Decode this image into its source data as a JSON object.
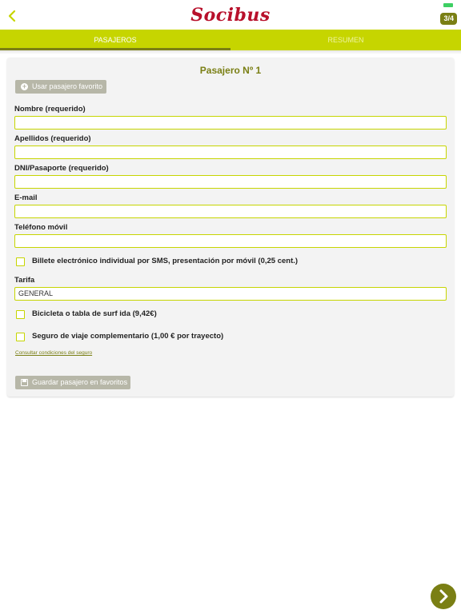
{
  "header": {
    "logo_text": "Socibus",
    "step_indicator": "3/4",
    "back_icon": "chevron-left-icon"
  },
  "tabs": [
    {
      "label": "PASAJEROS",
      "active": true
    },
    {
      "label": "RESUMEN",
      "active": false
    }
  ],
  "form": {
    "title": "Pasajero Nº 1",
    "use_favorite_button": "Usar pasajero favorito",
    "fields": {
      "nombre": {
        "label": "Nombre (requerido)",
        "value": ""
      },
      "apellidos": {
        "label": "Apellidos (requerido)",
        "value": ""
      },
      "dni": {
        "label": "DNI/Pasaporte (requerido)",
        "value": ""
      },
      "email": {
        "label": "E-mail",
        "value": ""
      },
      "telefono": {
        "label": "Teléfono móvil",
        "value": ""
      }
    },
    "sms_ticket": {
      "label": "Billete electrónico individual por SMS, presentación por móvil (0,25 cent.)",
      "checked": false
    },
    "tarifa": {
      "label": "Tarifa",
      "value": "GENERAL"
    },
    "bicicleta": {
      "label": "Bicicleta o tabla de surf ida (9,42€)",
      "checked": false
    },
    "seguro": {
      "label": "Seguro de viaje complementario (1,00 € por trayecto)",
      "checked": false
    },
    "insurance_link": "Consultar condiciones del seguro",
    "save_favorite_button": "Guardar pasajero en favoritos"
  },
  "colors": {
    "accent": "#c6d500",
    "accent_dark": "#7a7f14",
    "brand": "#b8102b",
    "button_disabled": "#b7b7a8"
  }
}
